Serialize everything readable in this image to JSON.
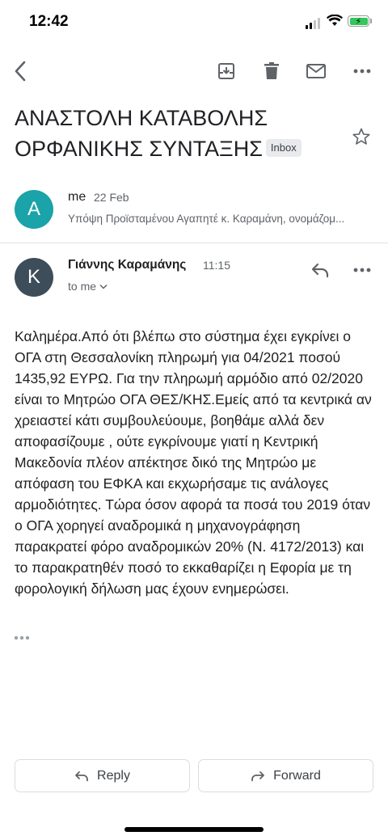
{
  "status_bar": {
    "time": "12:42"
  },
  "toolbar": {
    "back_icon": "chevron-left-icon",
    "archive_icon": "archive-icon",
    "delete_icon": "trash-icon",
    "mark_unread_icon": "mail-icon",
    "more_icon": "more-horizontal-icon"
  },
  "subject": {
    "line1": "ΑΝΑΣΤΟΛΗ ΚΑΤΑΒΟΛΗΣ",
    "line2": "ΟΡΦΑΝΙΚΗΣ ΣΥΝΤΑΞΗΣ",
    "label": "Inbox"
  },
  "messages": [
    {
      "avatar_letter": "A",
      "avatar_color": "#1aa3a8",
      "sender": "me",
      "date": "22 Feb",
      "snippet": "Υπόψη Προϊσταμένου Αγαπητέ κ. Καραμάνη, ονομάζομ..."
    },
    {
      "avatar_letter": "K",
      "avatar_color": "#3d4d59",
      "sender": "Γιάννης Καραμάνης",
      "time": "11:15",
      "recipient": "to me",
      "body": "Καλημέρα.Από ότι βλέπω στο σύστημα έχει εγκρίνει ο ΟΓΑ στη Θεσσαλονίκη πληρωμή για 04/2021 ποσού 1435,92 ΕΥΡΩ. Για την πληρωμή αρμόδιο από 02/2020 είναι το Μητρώο ΟΓΑ ΘΕΣ/ΚΗΣ.Εμείς από τα κεντρικά αν χρειαστεί κάτι συμβουλεύουμε, βοηθάμε αλλά δεν αποφασίζουμε , ούτε εγκρίνουμε γιατί η Κεντρική Μακεδονία πλέον  απέκτησε δικό της Μητρώο με  απόφαση του ΕΦΚΑ και εκχωρήσαμε τις ανάλογες αρμοδιότητες. Τώρα όσον αφορά τα ποσά του 2019 όταν ο ΟΓΑ χορηγεί αναδρομικά η μηχανογράφηση παρακρατεί φόρο αναδρομικών 20% (Ν. 4172/2013) και το παρακρατηθέν ποσό το εκκαθαρίζει η Εφορία με τη φορολογική δήλωση μας έχουν ενημερώσει."
    }
  ],
  "actions": {
    "reply_label": "Reply",
    "forward_label": "Forward"
  }
}
